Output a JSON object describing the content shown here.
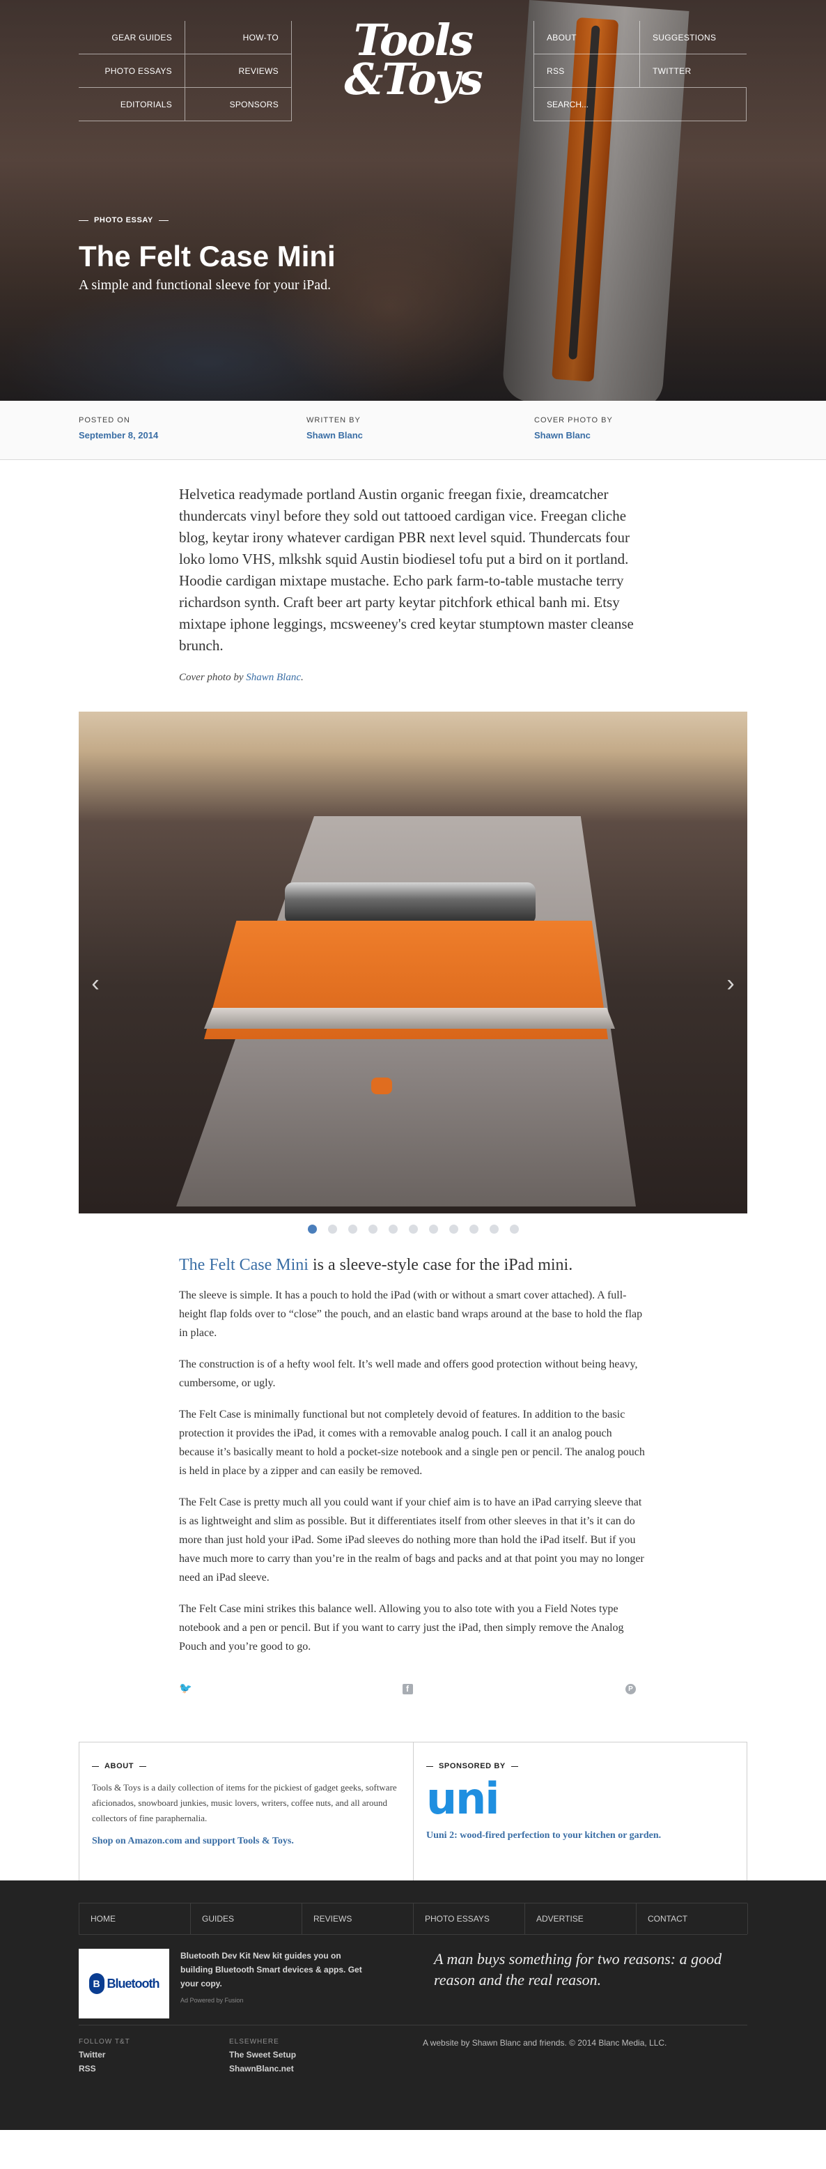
{
  "nav": {
    "left": [
      "GEAR GUIDES",
      "HOW-TO",
      "PHOTO ESSAYS",
      "REVIEWS",
      "EDITORIALS",
      "SPONSORS"
    ],
    "right": [
      "ABOUT",
      "SUGGESTIONS",
      "RSS",
      "TWITTER"
    ],
    "search_placeholder": "SEARCH..."
  },
  "logo": {
    "line1": "Tools",
    "line2": "&Toys"
  },
  "hero": {
    "kicker": "PHOTO ESSAY",
    "title": "The Felt Case Mini",
    "subtitle": "A simple and functional sleeve for your iPad."
  },
  "meta": {
    "posted_label": "POSTED ON",
    "posted_value": "September 8, 2014",
    "written_label": "WRITTEN BY",
    "written_value": "Shawn Blanc",
    "cover_label": "COVER PHOTO BY",
    "cover_value": "Shawn Blanc"
  },
  "article": {
    "intro": "Helvetica readymade portland Austin organic freegan fixie, dreamcatcher thundercats vinyl before they sold out tattooed cardigan vice. Freegan cliche blog, keytar irony whatever cardigan PBR next level squid. Thundercats four loko lomo VHS, mlkshk squid Austin biodiesel tofu put a bird on it portland. Hoodie cardigan mixtape mustache. Echo park farm-to-table mustache terry richardson synth. Craft beer art party keytar pitchfork ethical banh mi. Etsy mixtape iphone leggings, mcsweeney's cred keytar stumptown master cleanse brunch.",
    "credit_prefix": "Cover photo by ",
    "credit_name": "Shawn Blanc",
    "credit_suffix": ".",
    "lead_link": "The Felt Case Mini",
    "lead_rest": " is a sleeve-style case for the iPad mini.",
    "paragraphs": [
      "The sleeve is simple. It has a pouch to hold the iPad (with or without a smart cover attached). A full-height flap folds over to “close” the pouch, and an elastic band wraps around at the base to hold the flap in place.",
      "The construction is of a hefty wool felt. It’s well made and offers good protection without being heavy, cumbersome, or ugly.",
      "The Felt Case is minimally functional but not completely devoid of features. In addition to the basic protection it provides the iPad, it comes with a removable analog pouch. I call it an analog pouch because it’s basically meant to hold a pocket-size notebook and a single pen or pencil. The analog pouch is held in place by a zipper and can easily be removed.",
      "The Felt Case is pretty much all you could want if your chief aim is to have an iPad carrying sleeve that is as lightweight and slim as possible. But it differentiates itself from other sleeves in that it’s it can do more than just hold your iPad. Some iPad sleeves do nothing more than hold the iPad itself. But if you have much more to carry than you’re in the realm of bags and packs and at that point you may no longer need an iPad sleeve.",
      "The Felt Case mini strikes this balance well. Allowing you to also tote with you a Field Notes type notebook and a pen or pencil. But if you want to carry just the iPad, then simply remove the Analog Pouch and you’re good to go."
    ]
  },
  "slider": {
    "total": 11,
    "active": 0,
    "prev": "‹",
    "next": "›"
  },
  "share": {
    "twitter_glyph": "🐦",
    "facebook_glyph": "f",
    "pinterest_glyph": "P"
  },
  "about": {
    "heading": "ABOUT",
    "text": "Tools & Toys is a daily collection of items for the pickiest of gadget geeks, software aficionados, snowboard junkies, music lovers, writers, coffee nuts, and all around collectors of fine paraphernalia.",
    "link": "Shop on Amazon.com and support Tools & Toys."
  },
  "sponsor": {
    "heading": "SPONSORED BY",
    "logo_text": "uni",
    "link": "Uuni 2: wood-fired perfection to your kitchen or garden."
  },
  "footer": {
    "nav": [
      "HOME",
      "GUIDES",
      "REVIEWS",
      "PHOTO ESSAYS",
      "ADVERTISE",
      "CONTACT"
    ],
    "ad_brand": "Bluetooth",
    "ad_badge": "B",
    "ad_text": "Bluetooth Dev Kit New kit guides you on building Bluetooth Smart devices & apps. Get your copy.",
    "ad_meta": "Ad Powered by Fusion",
    "quote": "A man buys something for two reasons: a good reason and the real reason.",
    "follow_label": "FOLLOW T&T",
    "follow_links": [
      "Twitter",
      "RSS"
    ],
    "elsewhere_label": "ELSEWHERE",
    "elsewhere_links": [
      "The Sweet Setup",
      "ShawnBlanc.net"
    ],
    "copyright": "A website by Shawn Blanc and friends. © 2014 Blanc Media, LLC."
  },
  "colors": {
    "link": "#3a6ea5",
    "footer_bg": "#232323",
    "accent_orange": "#ec7a24",
    "dot_active": "#4a7ebb"
  }
}
